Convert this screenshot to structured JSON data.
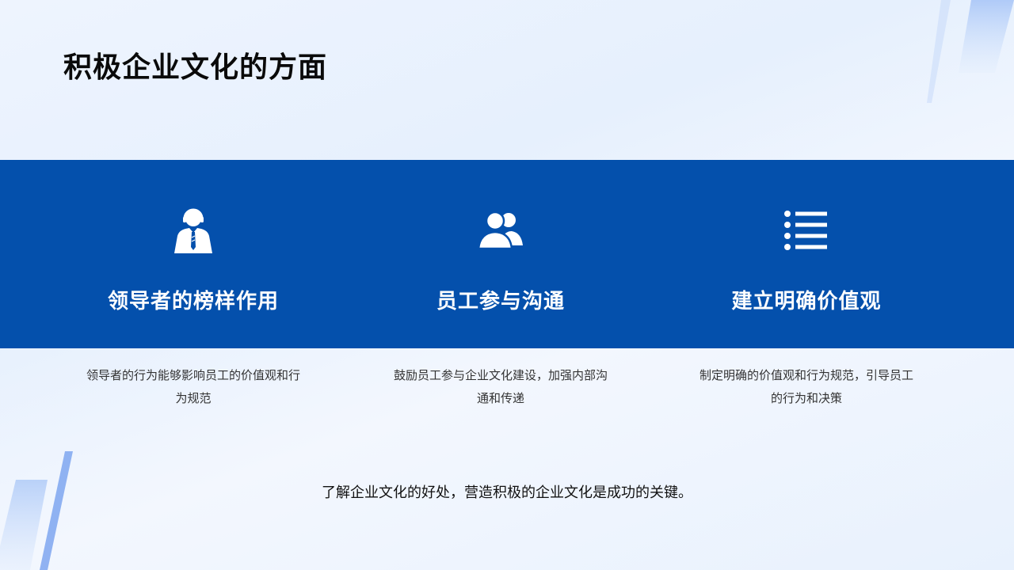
{
  "page": {
    "title": "积极企业文化的方面",
    "footer": "了解企业文化的好处，营造积极的企业文化是成功的关键。"
  },
  "colors": {
    "band": "#0450ac",
    "title_text": "#0a0a0a",
    "band_text": "#ffffff",
    "desc_text": "#333333"
  },
  "cards": [
    {
      "icon": "leader-icon",
      "title": "领导者的榜样作用",
      "desc": "领导者的行为能够影响员工的价值观和行为规范"
    },
    {
      "icon": "users-icon",
      "title": "员工参与沟通",
      "desc": "鼓励员工参与企业文化建设，加强内部沟通和传递"
    },
    {
      "icon": "list-icon",
      "title": "建立明确价值观",
      "desc": "制定明确的价值观和行为规范，引导员工的行为和决策"
    }
  ]
}
